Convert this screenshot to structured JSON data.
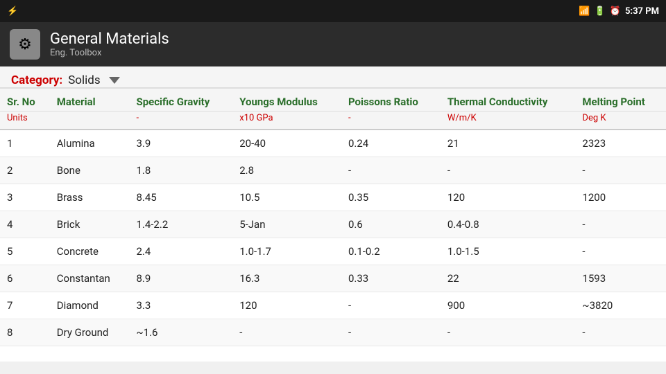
{
  "statusBar": {
    "usbIcon": "⚡",
    "signalBars": "▂▄▆█",
    "batteryIcon": "🔋",
    "alarmIcon": "⏰",
    "time": "5:37 PM"
  },
  "header": {
    "title": "General Materials",
    "subtitle": "Eng. Toolbox",
    "icon": "⚙"
  },
  "category": {
    "label": "Category:",
    "value": "Solids"
  },
  "table": {
    "columns": [
      {
        "label": "Sr. No",
        "unit": "Units"
      },
      {
        "label": "Material",
        "unit": ""
      },
      {
        "label": "Specific Gravity",
        "unit": "-"
      },
      {
        "label": "Youngs Modulus",
        "unit": "x10 GPa"
      },
      {
        "label": "Poissons Ratio",
        "unit": "-"
      },
      {
        "label": "Thermal Conductivity",
        "unit": "W/m/K"
      },
      {
        "label": "Melting Point",
        "unit": "Deg K"
      }
    ],
    "rows": [
      {
        "no": "1",
        "material": "Alumina",
        "sg": "3.9",
        "ym": "20-40",
        "pr": "0.24",
        "tc": "21",
        "mp": "2323"
      },
      {
        "no": "2",
        "material": "Bone",
        "sg": "1.8",
        "ym": "2.8",
        "pr": "-",
        "tc": "-",
        "mp": "-"
      },
      {
        "no": "3",
        "material": "Brass",
        "sg": "8.45",
        "ym": "10.5",
        "pr": "0.35",
        "tc": "120",
        "mp": "1200"
      },
      {
        "no": "4",
        "material": "Brick",
        "sg": "1.4-2.2",
        "ym": "5-Jan",
        "pr": "0.6",
        "tc": "0.4-0.8",
        "mp": "-"
      },
      {
        "no": "5",
        "material": "Concrete",
        "sg": "2.4",
        "ym": "1.0-1.7",
        "pr": "0.1-0.2",
        "tc": "1.0-1.5",
        "mp": "-"
      },
      {
        "no": "6",
        "material": "Constantan",
        "sg": "8.9",
        "ym": "16.3",
        "pr": "0.33",
        "tc": "22",
        "mp": "1593"
      },
      {
        "no": "7",
        "material": "Diamond",
        "sg": "3.3",
        "ym": "120",
        "pr": "-",
        "tc": "900",
        "mp": "~3820"
      },
      {
        "no": "8",
        "material": "Dry Ground",
        "sg": "~1.6",
        "ym": "-",
        "pr": "-",
        "tc": "-",
        "mp": "-"
      }
    ]
  }
}
